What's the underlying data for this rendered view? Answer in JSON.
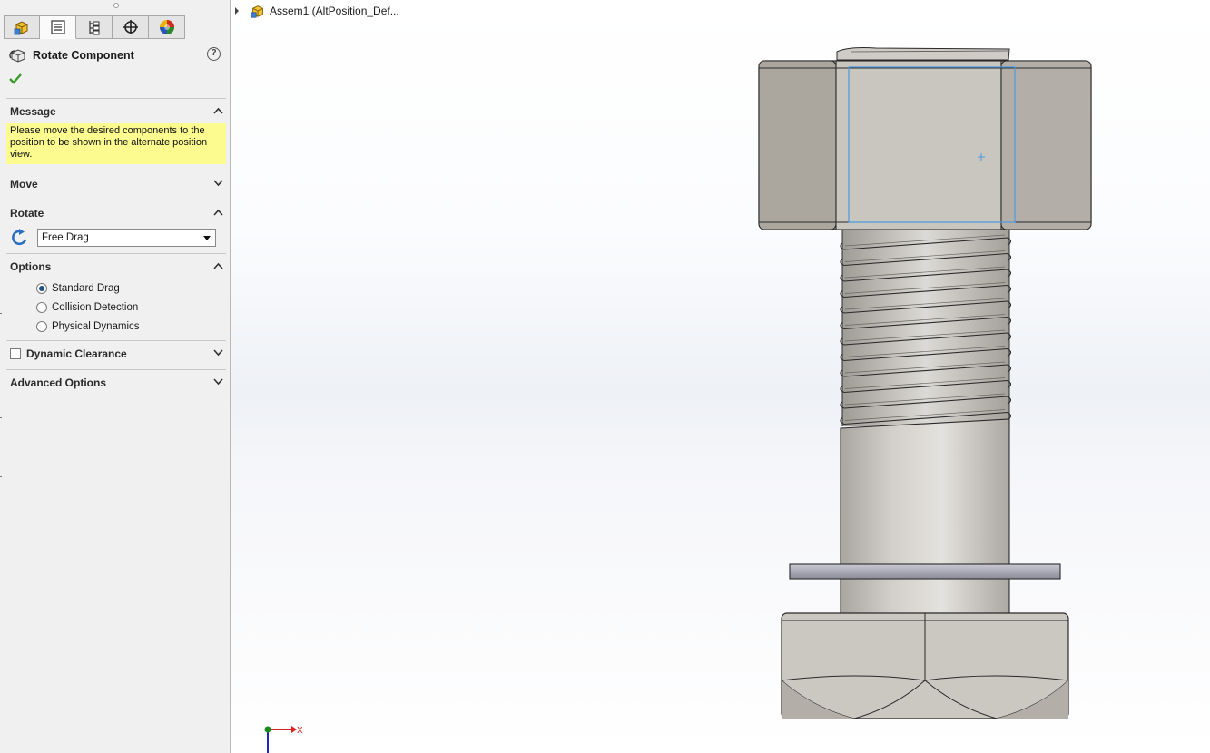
{
  "panel": {
    "tabs": [
      {
        "name": "featuremanager-tab",
        "icon": "assembly-icon"
      },
      {
        "name": "propertymanager-tab",
        "icon": "property-list-icon"
      },
      {
        "name": "configurationmanager-tab",
        "icon": "configuration-icon"
      },
      {
        "name": "dimxpertmanager-tab",
        "icon": "crosshair-icon"
      },
      {
        "name": "displaymanager-tab",
        "icon": "appearance-icon"
      }
    ],
    "active_tab": 1,
    "title": "Rotate Component",
    "help": "?",
    "sections": {
      "message": {
        "label": "Message",
        "text": "Please move the desired components to the position to be shown in the alternate position view."
      },
      "move": {
        "label": "Move"
      },
      "rotate": {
        "label": "Rotate",
        "mode": "Free Drag"
      },
      "options": {
        "label": "Options",
        "radios": [
          {
            "label": "Standard Drag",
            "selected": true
          },
          {
            "label": "Collision Detection",
            "selected": false
          },
          {
            "label": "Physical Dynamics",
            "selected": false
          }
        ]
      },
      "dynamic_clearance": {
        "label": "Dynamic Clearance",
        "checked": false
      },
      "advanced_options": {
        "label": "Advanced Options"
      }
    }
  },
  "viewport": {
    "tree_item": "Assem1  (AltPosition_Def...",
    "triad_x_label": "X"
  },
  "colors": {
    "message_bg": "#fbfb8f",
    "accept_green": "#3a9a2a",
    "selection_blue": "#4a9ae0"
  }
}
